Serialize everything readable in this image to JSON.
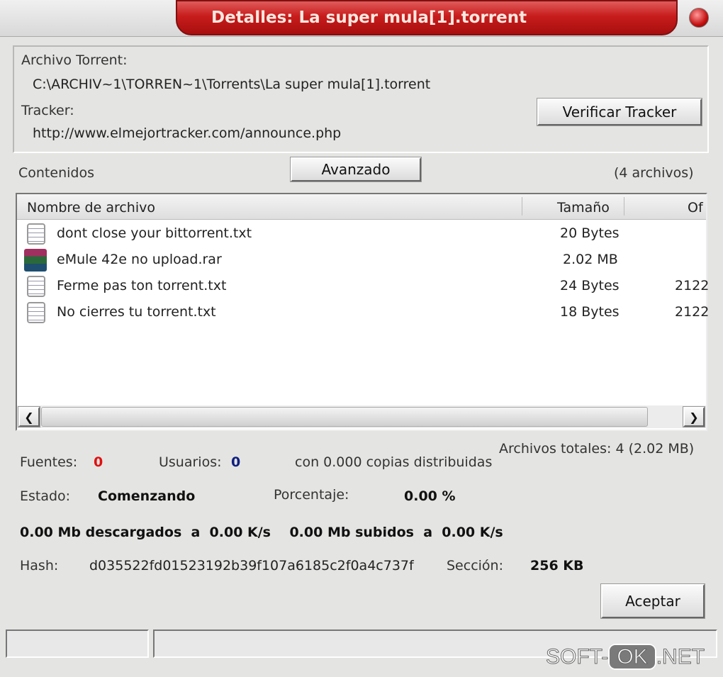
{
  "window": {
    "title": "Detalles: La super mula[1].torrent"
  },
  "torrent": {
    "file_label": "Archivo Torrent:",
    "file_path": "C:\\ARCHIV~1\\TORREN~1\\Torrents\\La super mula[1].torrent",
    "tracker_label": "Tracker:",
    "tracker_url": "http://www.elmejortracker.com/announce.php",
    "verify_button": "Verificar Tracker"
  },
  "contents": {
    "label": "Contenidos",
    "advanced_button": "Avanzado",
    "count": "(4 archivos)"
  },
  "table": {
    "columns": [
      "Nombre de archivo",
      "Tamaño",
      "Of"
    ],
    "rows": [
      {
        "icon": "text-file-icon",
        "name": "dont close your bittorrent.txt",
        "size": "20 Bytes",
        "offset": ""
      },
      {
        "icon": "rar-archive-icon",
        "name": "eMule 42e no upload.rar",
        "size": "2.02 MB",
        "offset": ""
      },
      {
        "icon": "text-file-icon",
        "name": "Ferme pas ton torrent.txt",
        "size": "24 Bytes",
        "offset": "2122"
      },
      {
        "icon": "text-file-icon",
        "name": "No cierres tu torrent.txt",
        "size": "18 Bytes",
        "offset": "2122"
      }
    ]
  },
  "stats": {
    "total": "Archivos totales: 4 (2.02 MB)",
    "sources_label": "Fuentes:",
    "sources": "0",
    "users_label": "Usuarios:",
    "users": "0",
    "copies": "con 0.000 copias distribuidas",
    "state_label": "Estado:",
    "state": "Comenzando",
    "percent_label": "Porcentaje:",
    "percent": "0.00 %",
    "transfer": "0.00 Mb descargados  a  0.00 K/s    0.00 Mb subidos  a  0.00 K/s",
    "hash_label": "Hash:",
    "hash": "d035522fd01523192b39f107a6185c2f0a4c737f",
    "section_label": "Sección:",
    "section": "256 KB",
    "colors": {
      "sources": "#e01010",
      "users": "#102080"
    }
  },
  "accept_button": "Aceptar",
  "watermark": {
    "a": "SOFT-",
    "b": "OK",
    ".c": "",
    "c": ".NET"
  }
}
